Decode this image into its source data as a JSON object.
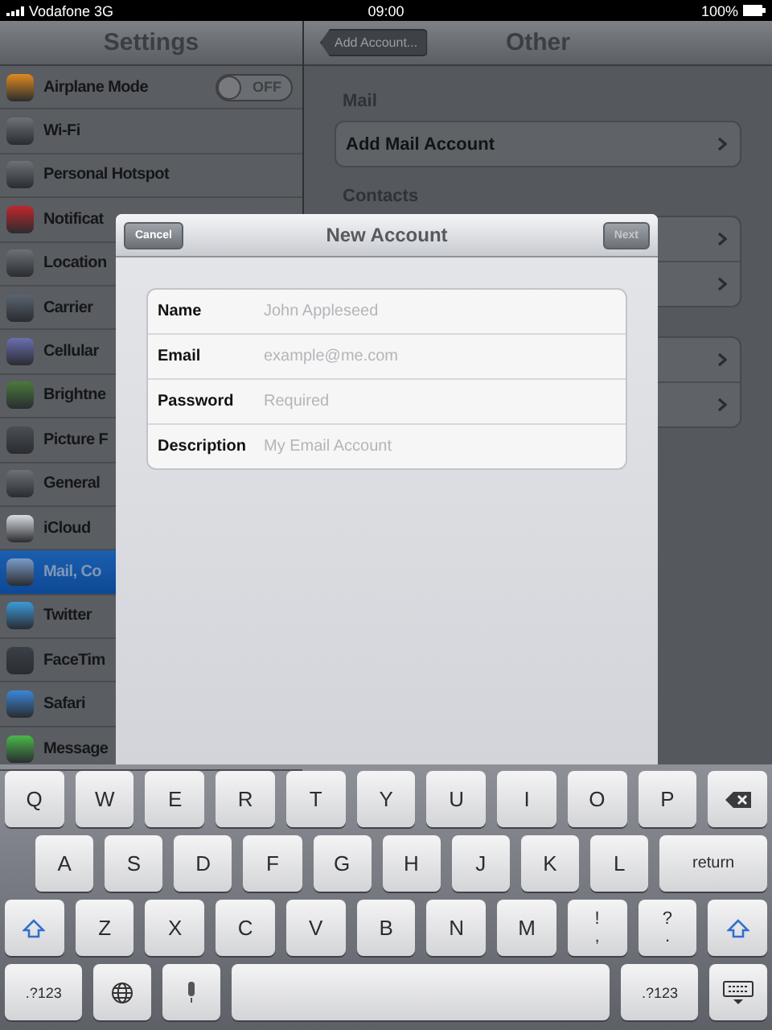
{
  "status_bar": {
    "carrier": "Vodafone 3G",
    "time": "09:00",
    "battery": "100%"
  },
  "sidebar": {
    "title": "Settings",
    "items": [
      {
        "label": "Airplane Mode",
        "selected": false,
        "kind": "toggle",
        "on": false,
        "toggle_text": "OFF"
      },
      {
        "label": "Wi-Fi",
        "selected": false,
        "kind": "plain"
      },
      {
        "label": "Personal Hotspot",
        "selected": false,
        "kind": "plain"
      },
      {
        "label": "Notificat",
        "selected": false,
        "kind": "plain"
      },
      {
        "label": "Location",
        "selected": false,
        "kind": "plain"
      },
      {
        "label": "Carrier",
        "selected": false,
        "kind": "plain"
      },
      {
        "label": "Cellular",
        "selected": false,
        "kind": "plain"
      },
      {
        "label": "Brightne",
        "selected": false,
        "kind": "plain"
      },
      {
        "label": "Picture F",
        "selected": false,
        "kind": "plain"
      },
      {
        "label": "General",
        "selected": false,
        "kind": "plain"
      },
      {
        "label": "iCloud",
        "selected": false,
        "kind": "plain"
      },
      {
        "label": "Mail, Co",
        "selected": true,
        "kind": "plain"
      },
      {
        "label": "Twitter",
        "selected": false,
        "kind": "plain"
      },
      {
        "label": "FaceTim",
        "selected": false,
        "kind": "plain"
      },
      {
        "label": "Safari",
        "selected": false,
        "kind": "plain"
      },
      {
        "label": "Message",
        "selected": false,
        "kind": "plain"
      }
    ]
  },
  "detail": {
    "back_button": "Add Account...",
    "title": "Other",
    "sections": [
      {
        "header": "Mail",
        "rows": [
          {
            "label": "Add Mail Account"
          }
        ]
      },
      {
        "header": "Contacts",
        "rows": [
          {},
          {}
        ]
      },
      {
        "rows": [
          {},
          {}
        ]
      }
    ]
  },
  "dialog": {
    "title": "New Account",
    "cancel": "Cancel",
    "next": {
      "label": "Next",
      "disabled": true
    },
    "fields": [
      {
        "label": "Name",
        "placeholder": "John Appleseed"
      },
      {
        "label": "Email",
        "placeholder": "example@me.com"
      },
      {
        "label": "Password",
        "placeholder": "Required"
      },
      {
        "label": "Description",
        "placeholder": "My Email Account"
      }
    ]
  },
  "keyboard": {
    "rows": [
      {
        "keys": [
          {
            "kind": "char",
            "label": "Q"
          },
          {
            "kind": "char",
            "label": "W"
          },
          {
            "kind": "char",
            "label": "E"
          },
          {
            "kind": "char",
            "label": "R"
          },
          {
            "kind": "char",
            "label": "T"
          },
          {
            "kind": "char",
            "label": "Y"
          },
          {
            "kind": "char",
            "label": "U"
          },
          {
            "kind": "char",
            "label": "I"
          },
          {
            "kind": "char",
            "label": "O"
          },
          {
            "kind": "char",
            "label": "P"
          },
          {
            "kind": "backspace"
          }
        ]
      },
      {
        "keys": [
          {
            "kind": "char",
            "label": "A"
          },
          {
            "kind": "char",
            "label": "S"
          },
          {
            "kind": "char",
            "label": "D"
          },
          {
            "kind": "char",
            "label": "F"
          },
          {
            "kind": "char",
            "label": "G"
          },
          {
            "kind": "char",
            "label": "H"
          },
          {
            "kind": "char",
            "label": "J"
          },
          {
            "kind": "char",
            "label": "K"
          },
          {
            "kind": "char",
            "label": "L"
          },
          {
            "kind": "wide",
            "label": "return"
          }
        ]
      },
      {
        "keys": [
          {
            "kind": "shift"
          },
          {
            "kind": "char",
            "label": "Z"
          },
          {
            "kind": "char",
            "label": "X"
          },
          {
            "kind": "char",
            "label": "C"
          },
          {
            "kind": "char",
            "label": "V"
          },
          {
            "kind": "char",
            "label": "B"
          },
          {
            "kind": "char",
            "label": "N"
          },
          {
            "kind": "char",
            "label": "M"
          },
          {
            "kind": "dual",
            "top": "!",
            "bottom": ","
          },
          {
            "kind": "dual",
            "top": "?",
            "bottom": "."
          },
          {
            "kind": "shift"
          }
        ]
      },
      {
        "keys": [
          {
            "kind": "small",
            "label": ".?123"
          },
          {
            "kind": "globe"
          },
          {
            "kind": "mic"
          },
          {
            "kind": "space"
          },
          {
            "kind": "small",
            "label": ".?123"
          },
          {
            "kind": "dismiss"
          }
        ]
      }
    ]
  }
}
